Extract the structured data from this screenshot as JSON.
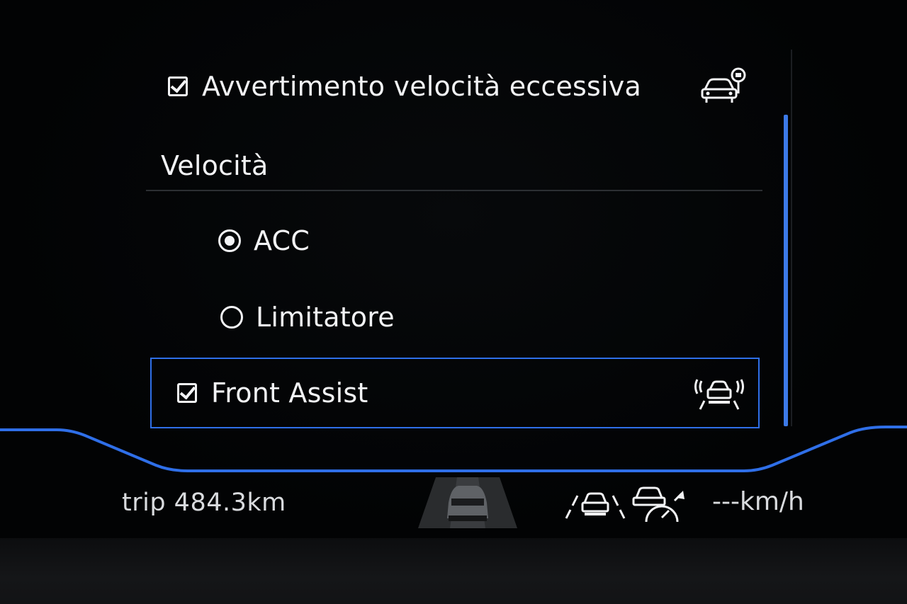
{
  "menu": {
    "overspeed_warning": {
      "label": "Avvertimento velocità eccessiva",
      "checked": true,
      "icon": "speed-warning-car-icon"
    },
    "section_title": "Velocità",
    "options": [
      {
        "label": "ACC",
        "selected": true
      },
      {
        "label": "Limitatore",
        "selected": false
      }
    ],
    "front_assist": {
      "label": "Front Assist",
      "checked": true,
      "focused": true,
      "icon": "front-assist-icon"
    }
  },
  "status_bar": {
    "trip": "trip 484.3km",
    "speed": "---km/h",
    "icons": [
      "car-on-road-icon",
      "lane-assist-icon",
      "acc-speed-icon"
    ]
  },
  "colors": {
    "accent": "#2f6fe8",
    "text": "#f2f3f5",
    "background": "#030405"
  }
}
